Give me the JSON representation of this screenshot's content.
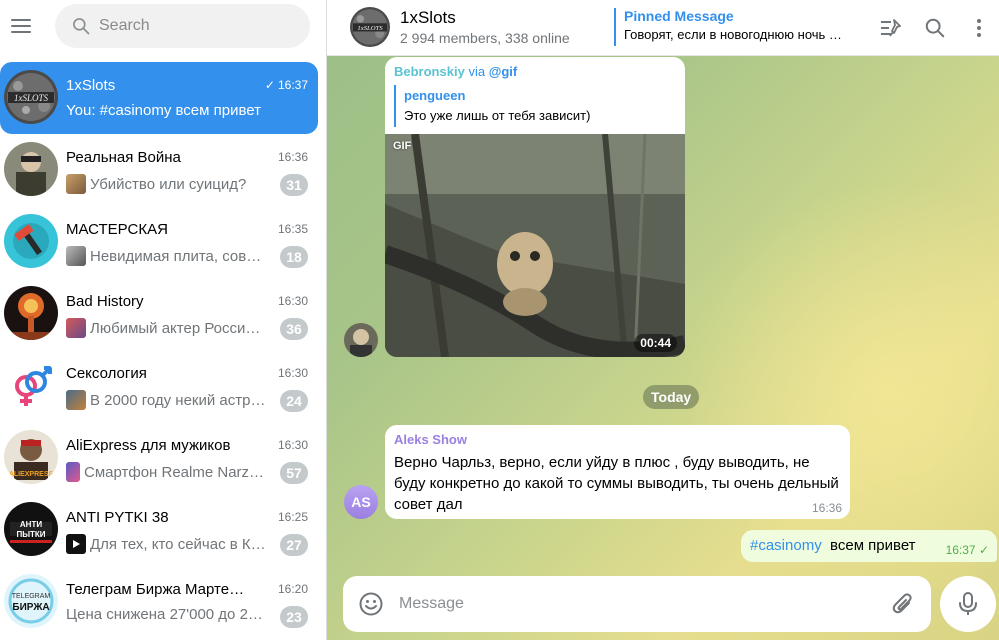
{
  "sidebar": {
    "search_placeholder": "Search",
    "chats": [
      {
        "title": "1xSlots",
        "time": "16:37",
        "preview": "You: #casinomy всем привет",
        "active": true,
        "read_check": "✓"
      },
      {
        "title": "Реальная Война",
        "time": "16:36",
        "preview": "Убийство или суицид?",
        "unread": "31"
      },
      {
        "title": "МАСТЕРСКАЯ",
        "time": "16:35",
        "preview": "Невидимая плита, сов…",
        "unread": "18"
      },
      {
        "title": "Bad History",
        "time": "16:30",
        "preview": "Любимый актер Росси…",
        "unread": "36"
      },
      {
        "title": "Сексология",
        "time": "16:30",
        "preview": "В 2000 году некий астр…",
        "unread": "24"
      },
      {
        "title": "AliExpress для мужиков",
        "time": "16:30",
        "preview": "Смартфон Realme Narz…",
        "unread": "57"
      },
      {
        "title": "ANTI PYTKI 38",
        "time": "16:25",
        "preview": "Для тех, кто сейчас в К…",
        "unread": "27"
      },
      {
        "title": "Телеграм Биржа Марте…",
        "time": "16:20",
        "preview": "Цена снижена 27'000 до 2…",
        "unread": "23"
      }
    ]
  },
  "header": {
    "title": "1xSlots",
    "subtitle": "2 994 members, 338 online",
    "pinned_title": "Pinned Message",
    "pinned_text": "Говорят, если в новогоднюю ночь …"
  },
  "messages": {
    "gif_msg": {
      "sender": "Bebronskiy",
      "via": "via",
      "bot": "@gif",
      "reply_name": "pengueen",
      "reply_text": "Это уже лишь от тебя зависит)",
      "gif_label": "GIF",
      "duration": "00:44"
    },
    "date_sep": "Today",
    "text_msg": {
      "sender": "Aleks Show",
      "avatar_initials": "AS",
      "body": "Верно Чарльз, верно, если уйду в плюс , буду выводить, не буду конкретно до какой то суммы выводить, ты очень дельный совет дал",
      "time": "16:36"
    },
    "out_msg": {
      "hashtag": "#casinomy",
      "text": "всем привет",
      "time": "16:37",
      "check": "✓"
    }
  },
  "composer": {
    "placeholder": "Message"
  },
  "colors": {
    "accent": "#3390ec",
    "badge": "#c4c9cc",
    "outgoing": "#effdde"
  }
}
